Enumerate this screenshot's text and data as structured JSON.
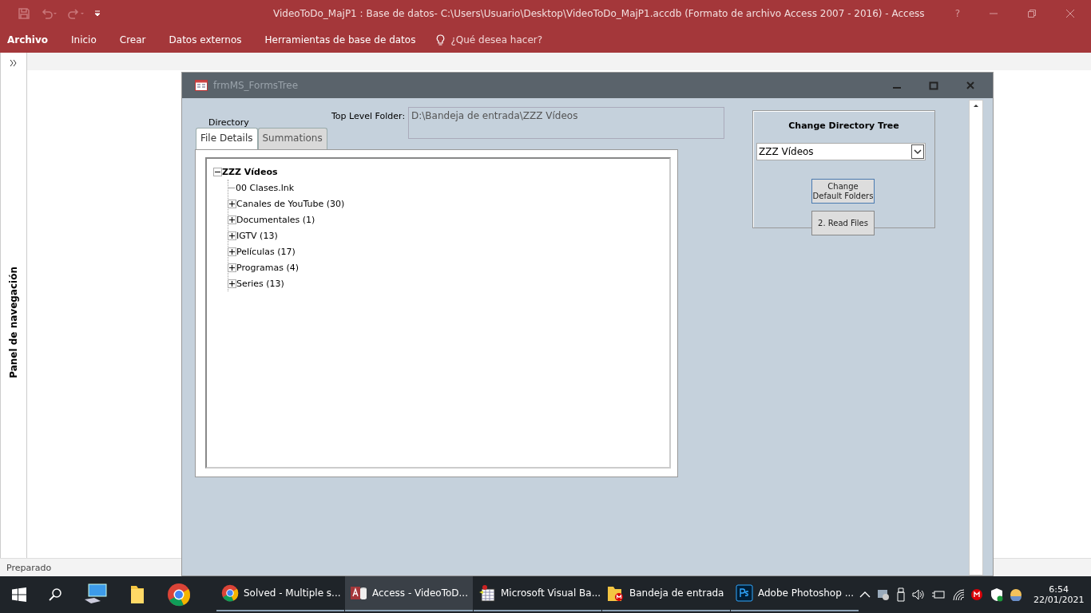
{
  "window": {
    "title": "VideoToDo_MajP1 : Base de datos- C:\\Users\\Usuario\\Desktop\\VideoToDo_MajP1.accdb (Formato de archivo Access 2007 - 2016) - Access",
    "help": "?"
  },
  "ribbon_tabs": [
    {
      "label": "Archivo",
      "selected": true
    },
    {
      "label": "Inicio",
      "selected": false
    },
    {
      "label": "Crear",
      "selected": false
    },
    {
      "label": "Datos externos",
      "selected": false
    },
    {
      "label": "Herramientas de base de datos",
      "selected": false
    }
  ],
  "tell_me": {
    "placeholder": "¿Qué desea hacer?"
  },
  "nav_pane": {
    "label": "Panel de navegación"
  },
  "status_bar": "Preparado",
  "form": {
    "title": "frmMS_FormsTree",
    "directory_label": "Directory",
    "tabs": [
      {
        "label": "File Details",
        "selected": true
      },
      {
        "label": "Summations",
        "selected": false
      }
    ],
    "top_level_label": "Top Level Folder:",
    "top_level_value": "D:\\Bandeja de entrada\\ZZZ Vídeos",
    "tree": [
      {
        "label": "ZZZ Vídeos",
        "expanded": true,
        "children": [
          {
            "label": "00 Clases.lnk"
          },
          {
            "label": "Canales de YouTube (30)",
            "expanded": false
          },
          {
            "label": "Documentales (1)",
            "expanded": false
          },
          {
            "label": "IGTV (13)",
            "expanded": false
          },
          {
            "label": "Películas (17)",
            "expanded": false
          },
          {
            "label": "Programas (4)",
            "expanded": false
          },
          {
            "label": "Series (13)",
            "expanded": false
          }
        ]
      }
    ],
    "change_tree": {
      "title": "Change Directory Tree",
      "value": "ZZZ Vídeos",
      "buttons": [
        "Change Default Folders",
        "2. Read Files"
      ]
    }
  },
  "taskbar": {
    "items": [
      {
        "label": "Solved - Multiple s...",
        "kind": "chrome",
        "selected": false
      },
      {
        "label": "Access - VideoToD...",
        "kind": "access",
        "selected": true
      },
      {
        "label": "Microsoft Visual Ba...",
        "kind": "vba",
        "selected": false
      },
      {
        "label": "Bandeja de entrada",
        "kind": "folder",
        "selected": false
      },
      {
        "label": "Adobe Photoshop ...",
        "kind": "photoshop",
        "selected": false
      }
    ],
    "time": "6:54",
    "date": "22/01/2021"
  }
}
